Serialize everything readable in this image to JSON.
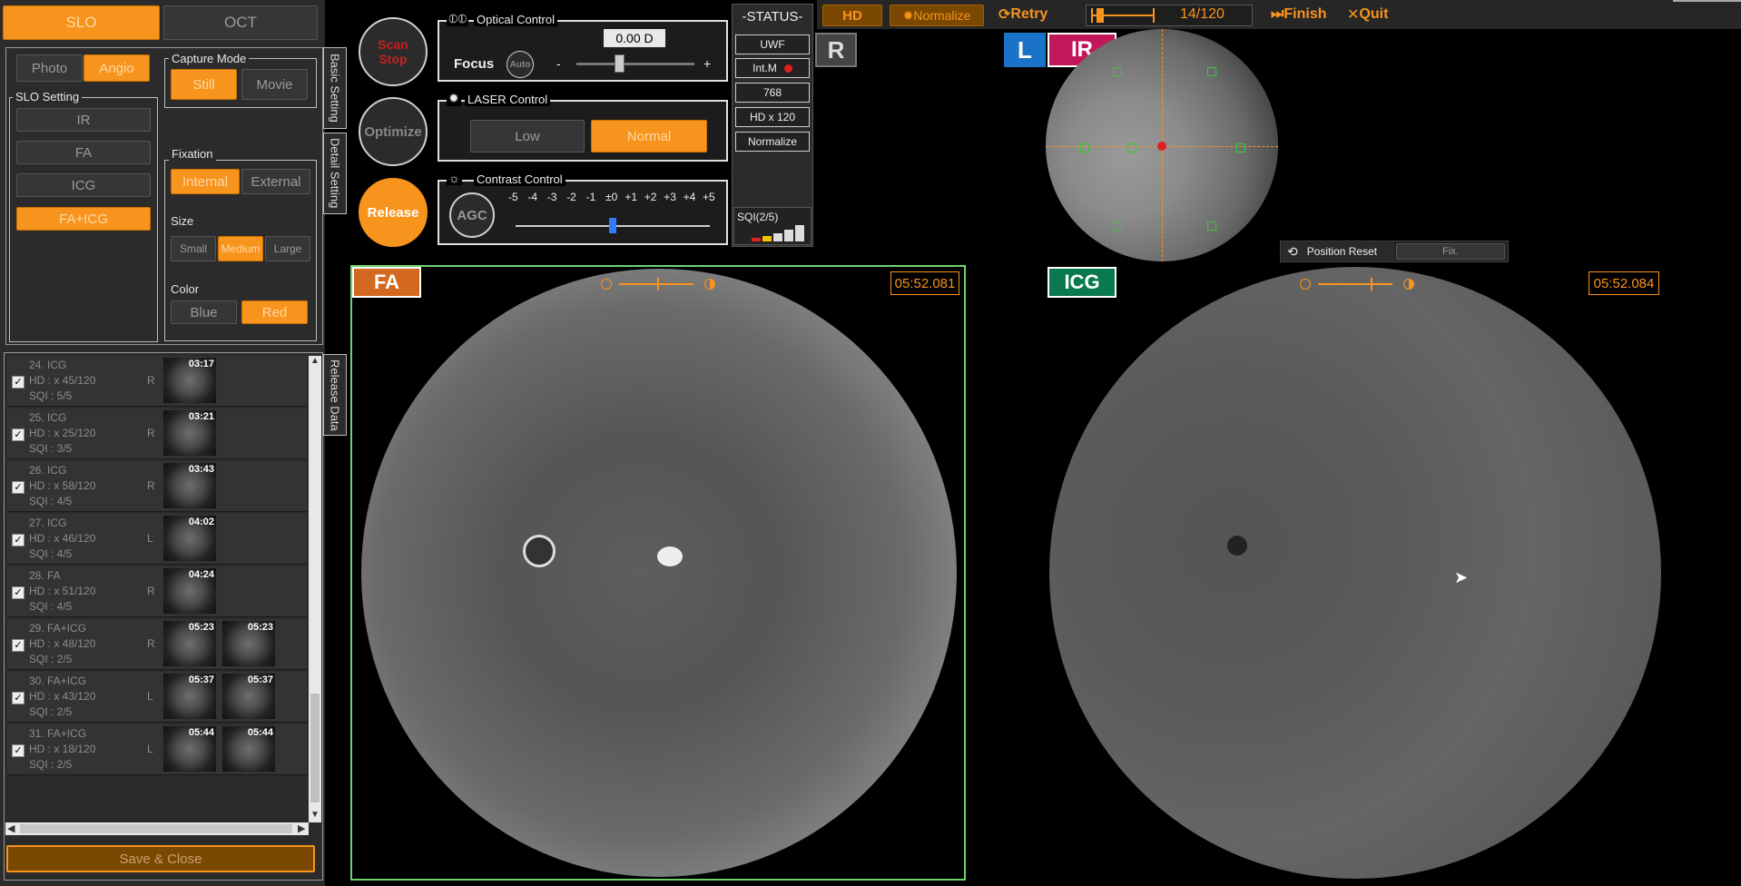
{
  "mode_tabs": {
    "slo": "SLO",
    "oct": "OCT"
  },
  "basic": {
    "photo": "Photo",
    "angio": "Angio",
    "capture_mode_title": "Capture Mode",
    "still": "Still",
    "movie": "Movie",
    "slo_setting_title": "SLO Setting",
    "ir": "IR",
    "fa": "FA",
    "icg": "ICG",
    "faicg": "FA+ICG",
    "fixation_title": "Fixation",
    "internal": "Internal",
    "external": "External",
    "size_title": "Size",
    "small": "Small",
    "medium": "Medium",
    "large": "Large",
    "color_title": "Color",
    "blue": "Blue",
    "red": "Red",
    "tab_basic": "Basic Setting",
    "tab_detail": "Detail Setting",
    "tab_release": "Release Data"
  },
  "circles": {
    "scan_stop": "Scan Stop",
    "optimize": "Optimize",
    "release": "Release"
  },
  "optical": {
    "title": "Optical Control",
    "diopter": "0.00 D",
    "focus": "Focus",
    "auto": "Auto",
    "minus": "-",
    "plus": "+",
    "focus_level": 0.35
  },
  "laser": {
    "title": "LASER Control",
    "low": "Low",
    "normal": "Normal"
  },
  "contrast": {
    "title": "Contrast Control",
    "agc": "AGC",
    "ticks": [
      "-5",
      "-4",
      "-3",
      "-2",
      "-1",
      "±0",
      "+1",
      "+2",
      "+3",
      "+4",
      "+5"
    ],
    "level": 0.5
  },
  "status": {
    "title": "-STATUS-",
    "uwf": "UWF",
    "intm": "Int.M",
    "res": "768",
    "hd": "HD x 120",
    "normalize": "Normalize",
    "sqi": "SQI(2/5)"
  },
  "toolbar": {
    "hd": "HD",
    "normalize": "Normalize",
    "retry": "Retry",
    "counter": "14/120",
    "progress": 0.117,
    "finish": "Finish",
    "quit": "Quit"
  },
  "eye_labels": {
    "r": "R",
    "l": "L",
    "ir": "IR"
  },
  "position": {
    "reset": "Position Reset",
    "fix": "Fix."
  },
  "release_list": [
    {
      "name": "24. ICG",
      "hd": "HD : x 45/120",
      "sqi": "SQI : 5/5",
      "eye": "R",
      "times": [
        "03:17"
      ]
    },
    {
      "name": "25. ICG",
      "hd": "HD : x 25/120",
      "sqi": "SQI : 3/5",
      "eye": "R",
      "times": [
        "03:21"
      ]
    },
    {
      "name": "26. ICG",
      "hd": "HD : x 58/120",
      "sqi": "SQI : 4/5",
      "eye": "R",
      "times": [
        "03:43"
      ]
    },
    {
      "name": "27. ICG",
      "hd": "HD : x 46/120",
      "sqi": "SQI : 4/5",
      "eye": "L",
      "times": [
        "04:02"
      ]
    },
    {
      "name": "28. FA",
      "hd": "HD : x 51/120",
      "sqi": "SQI : 4/5",
      "eye": "R",
      "times": [
        "04:24"
      ]
    },
    {
      "name": "29. FA+ICG",
      "hd": "HD : x 48/120",
      "sqi": "SQI : 2/5",
      "eye": "R",
      "times": [
        "05:23",
        "05:23"
      ]
    },
    {
      "name": "30. FA+ICG",
      "hd": "HD : x 43/120",
      "sqi": "SQI : 2/5",
      "eye": "L",
      "times": [
        "05:37",
        "05:37"
      ]
    },
    {
      "name": "31. FA+ICG",
      "hd": "HD : x 18/120",
      "sqi": "SQI : 2/5",
      "eye": "L",
      "times": [
        "05:44",
        "05:44"
      ]
    }
  ],
  "save_close": "Save & Close",
  "views": {
    "fa": {
      "label": "FA",
      "time": "05:52.081"
    },
    "icg": {
      "label": "ICG",
      "time": "05:52.084"
    }
  },
  "colors": {
    "accent": "#f7941d",
    "fa_tag": "#d2691e",
    "icg_tag": "#0a7a4e",
    "l_tag": "#1a73c8",
    "ir_tag": "#c2185b",
    "fa_border": "#6fd36f"
  }
}
